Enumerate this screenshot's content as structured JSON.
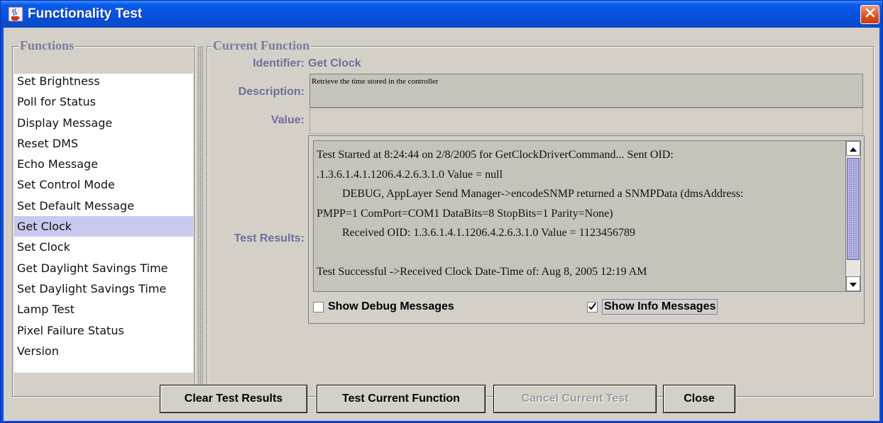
{
  "window": {
    "title": "Functionality Test",
    "app_icon": "java-cup-icon",
    "close_icon": "close-x-icon"
  },
  "functions_panel": {
    "title": "Functions",
    "items": [
      {
        "label": "Set Brightness",
        "selected": false
      },
      {
        "label": "Poll for Status",
        "selected": false
      },
      {
        "label": "Display Message",
        "selected": false
      },
      {
        "label": "Reset DMS",
        "selected": false
      },
      {
        "label": "Echo Message",
        "selected": false
      },
      {
        "label": "Set Control Mode",
        "selected": false
      },
      {
        "label": "Set Default Message",
        "selected": false
      },
      {
        "label": "Get Clock",
        "selected": true
      },
      {
        "label": "Set Clock",
        "selected": false
      },
      {
        "label": "Get Daylight Savings Time",
        "selected": false
      },
      {
        "label": "Set Daylight Savings Time",
        "selected": false
      },
      {
        "label": "Lamp Test",
        "selected": false
      },
      {
        "label": "Pixel Failure Status",
        "selected": false
      },
      {
        "label": "Version",
        "selected": false
      }
    ]
  },
  "current_function": {
    "title": "Current Function",
    "identifier_label": "Identifier:",
    "identifier_value": "Get Clock",
    "description_label": "Description:",
    "description_value": "Retrieve the time stored in the controller",
    "value_label": "Value:",
    "value_value": "",
    "test_results_label": "Test Results:",
    "results_lines": {
      "l1": "Test Started at 8:24:44 on 2/8/2005 for GetClockDriverCommand...        Sent OID:",
      "l2": ".1.3.6.1.4.1.1206.4.2.6.3.1.0 Value = null",
      "l3": "DEBUG, AppLayer Send Manager->encodeSNMP returned a SNMPData (dmsAddress:",
      "l4": "PMPP=1 ComPort=COM1 DataBits=8 StopBits=1 Parity=None)",
      "l5": "Received OID: 1.3.6.1.4.1.1206.4.2.6.3.1.0 Value = 1123456789",
      "l6": "",
      "l7": "Test Successful ->Received Clock Date-Time of: Aug 8, 2005 12:19 AM"
    },
    "show_debug_label": "Show Debug Messages",
    "show_debug_checked": false,
    "show_info_label": "Show Info Messages",
    "show_info_checked": true
  },
  "buttons": {
    "clear": "Clear Test Results",
    "test": "Test Current Function",
    "cancel": "Cancel Current Test",
    "close": "Close"
  },
  "colors": {
    "titlebar": "#0651dc",
    "panel_bg": "#d4d0c8",
    "label_text": "#6e6e9c",
    "selection": "#c9c9f0"
  }
}
